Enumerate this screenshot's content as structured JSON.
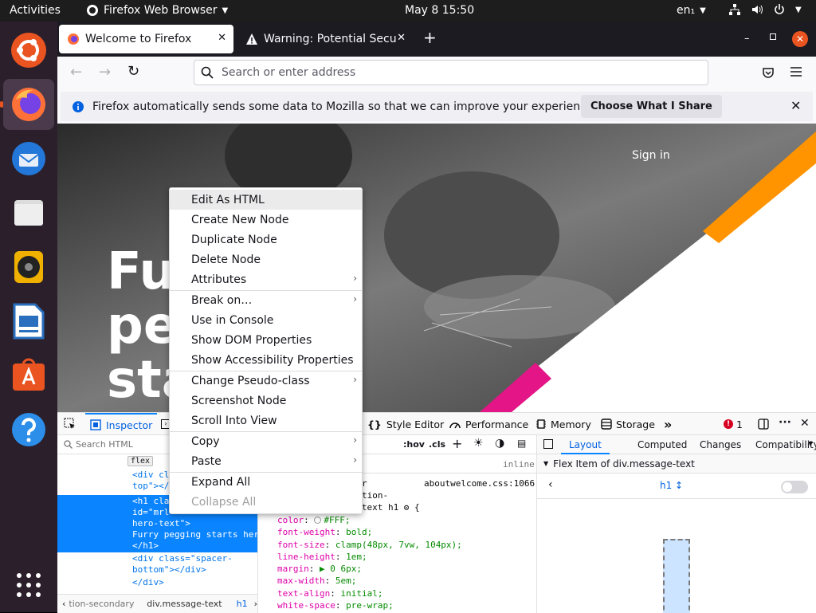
{
  "topbar": {
    "activities": "Activities",
    "app_name": "Firefox Web Browser",
    "clock": "May 8  15:50",
    "lang": "en₁"
  },
  "tabs": [
    {
      "label": "Welcome to Firefox"
    },
    {
      "label": "Warning: Potential Security Risk Ahead"
    }
  ],
  "navbar": {
    "url_placeholder": "Search or enter address"
  },
  "notification": {
    "text": "Firefox automatically sends some data to Mozilla so that we can improve your experience.",
    "button": "Choose What I Share"
  },
  "hero": {
    "sign_in": "Sign in",
    "lines": [
      "Fu",
      "pe",
      "sta"
    ]
  },
  "devtools": {
    "tabs": [
      "Inspector",
      "Style Editor",
      "Performance",
      "Memory",
      "Storage"
    ],
    "error_count": "1",
    "search_placeholder": "Search HTML",
    "hov": ":hov",
    "cls": ".cls",
    "side_tabs": [
      "Layout",
      "Computed",
      "Changes",
      "Compatibility"
    ],
    "flex_item_label": "Flex Item of div.message-text",
    "flex_selector": "h1 ↕",
    "markup": {
      "flex_badge": "flex",
      "line_div_cl": "<div cl",
      "line_top": "top\"></",
      "line_h1_cla": "<h1 cla",
      "line_id_mrl": "id=\"mrl",
      "line_hero_text": "hero-text\">",
      "line_furry": "Furry pegging starts her",
      "line_close_h1": "</h1>",
      "line_spacer1": "<div class=\"spacer-",
      "line_spacer2": "bottom\"></div>",
      "line_close_div": "</div>"
    },
    "rules": {
      "inline": "inline",
      "source": "aboutwelcome.css:1066",
      "sel1": "r",
      "sel2": "tion-",
      "sel3": "secondary .message-text h1 ⚙ {",
      "decls": [
        {
          "prop": "color",
          "val": "#FFF;"
        },
        {
          "prop": "font-weight",
          "val": "bold;"
        },
        {
          "prop": "font-size",
          "val": "clamp(48px, 7vw, 104px);"
        },
        {
          "prop": "line-height",
          "val": "1em;"
        },
        {
          "prop": "margin",
          "val": "▶ 0 6px;"
        },
        {
          "prop": "max-width",
          "val": "5em;"
        },
        {
          "prop": "text-align",
          "val": "initial;"
        },
        {
          "prop": "white-space",
          "val": "pre-wrap;"
        }
      ]
    },
    "breadcrumbs": [
      "tion-secondary",
      "div.message-text",
      "h1"
    ]
  },
  "context_menu": {
    "items": [
      {
        "label": "Edit As HTML",
        "submenu": false,
        "disabled": false
      },
      {
        "label": "Create New Node",
        "submenu": false,
        "disabled": false
      },
      {
        "label": "Duplicate Node",
        "submenu": false,
        "disabled": false
      },
      {
        "label": "Delete Node",
        "submenu": false,
        "disabled": false
      },
      {
        "label": "Attributes",
        "submenu": true,
        "disabled": false
      },
      {
        "label": "Break on…",
        "submenu": true,
        "disabled": false
      },
      {
        "label": "Use in Console",
        "submenu": false,
        "disabled": false
      },
      {
        "label": "Show DOM Properties",
        "submenu": false,
        "disabled": false
      },
      {
        "label": "Show Accessibility Properties",
        "submenu": false,
        "disabled": false
      },
      {
        "label": "Change Pseudo-class",
        "submenu": true,
        "disabled": false
      },
      {
        "label": "Screenshot Node",
        "submenu": false,
        "disabled": false
      },
      {
        "label": "Scroll Into View",
        "submenu": false,
        "disabled": false
      },
      {
        "label": "Copy",
        "submenu": true,
        "disabled": false
      },
      {
        "label": "Paste",
        "submenu": true,
        "disabled": false
      },
      {
        "label": "Expand All",
        "submenu": false,
        "disabled": false
      },
      {
        "label": "Collapse All",
        "submenu": false,
        "disabled": true
      }
    ]
  },
  "icons": {
    "arrow": "›"
  },
  "colors": {
    "accent": "#0060df",
    "selection": "#0a84ff",
    "ubuntu_orange": "#e95420",
    "hero_orange": "#ff9400",
    "hero_pink": "#e31587"
  }
}
